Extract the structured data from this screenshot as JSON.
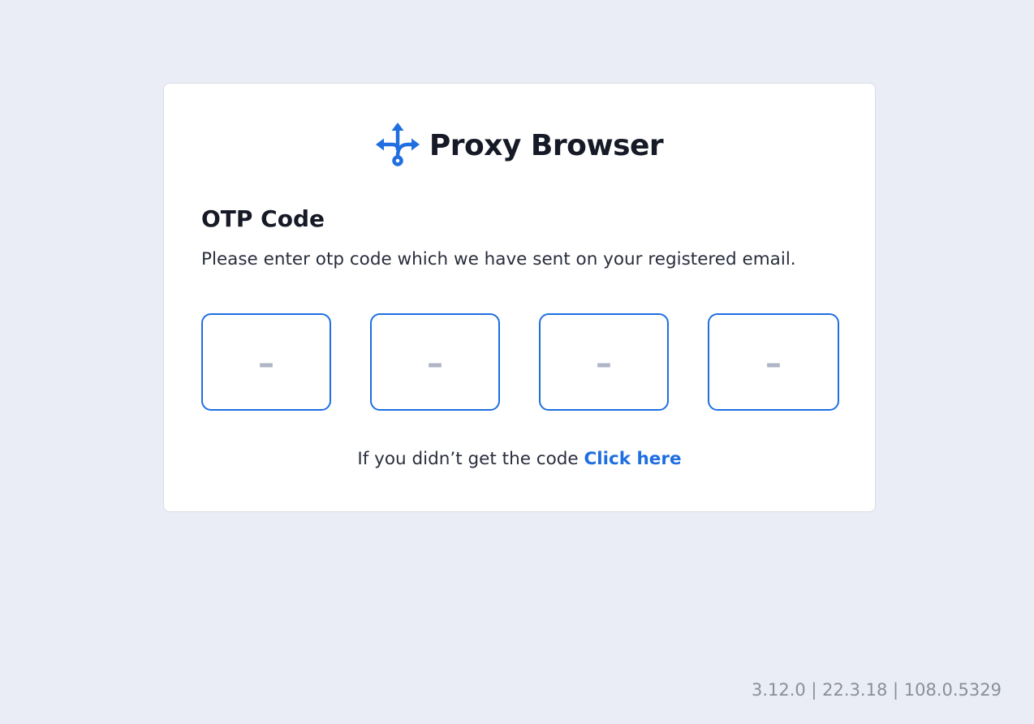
{
  "brand": {
    "name": "Proxy Browser",
    "logo_icon": "proxy-routes-icon",
    "accent_color": "#1f6fe0"
  },
  "otp": {
    "title": "OTP Code",
    "description": "Please enter otp code which we have sent on your registered email.",
    "digit_placeholders": [
      "–",
      "–",
      "–",
      "–"
    ],
    "digit_values": [
      "",
      "",
      "",
      ""
    ]
  },
  "resend": {
    "prompt": "If you didn’t get the code",
    "link_label": "Click here"
  },
  "footer": {
    "version": "3.12.0 | 22.3.18 | 108.0.5329"
  }
}
